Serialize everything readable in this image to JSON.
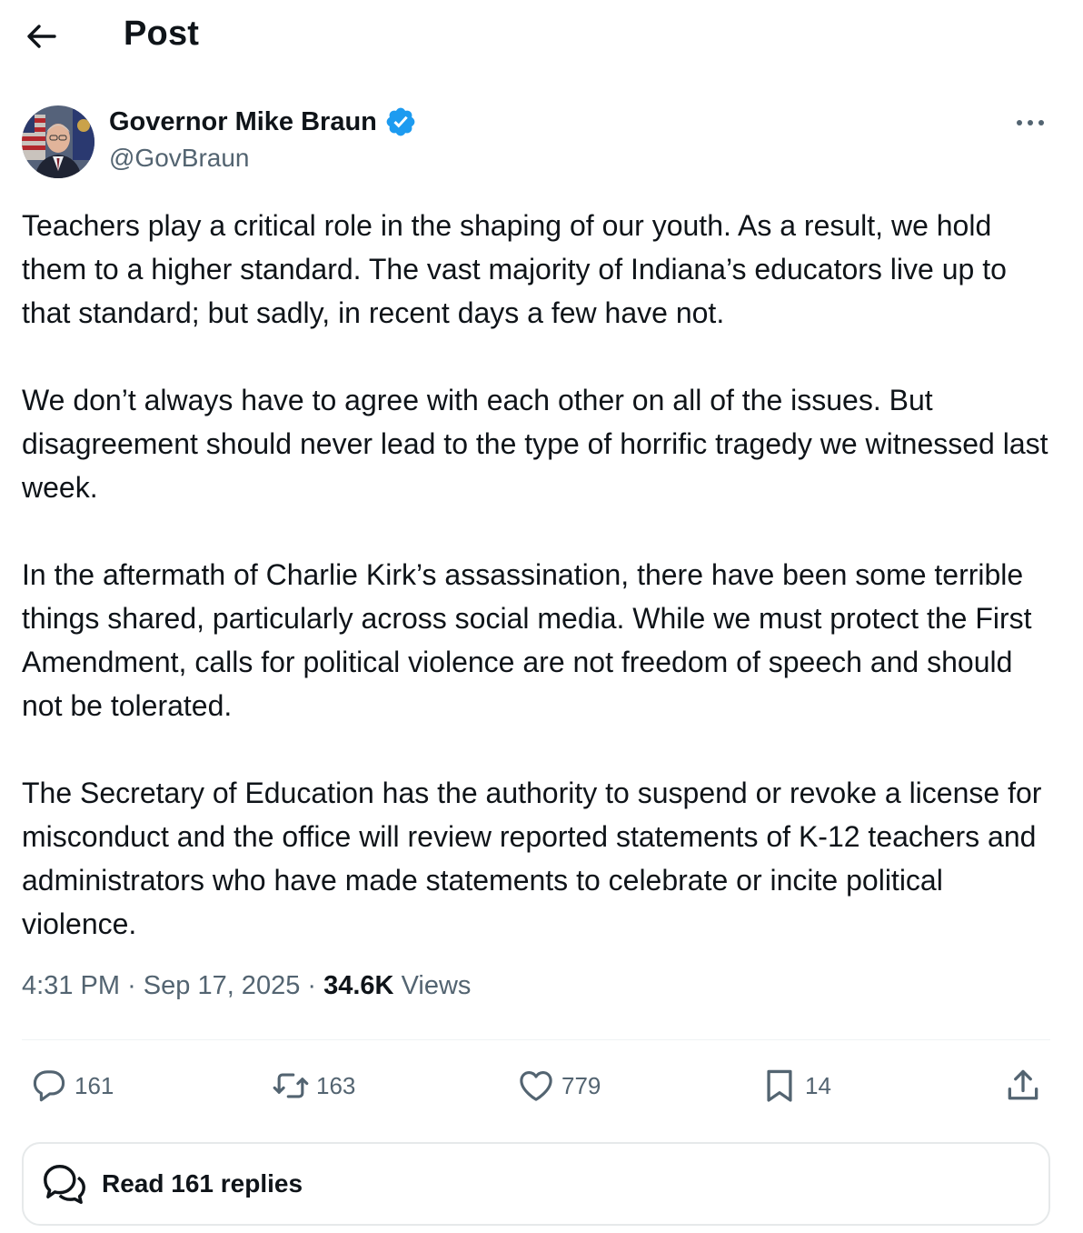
{
  "header": {
    "back_icon": "arrow-left-icon",
    "title": "Post"
  },
  "author": {
    "display_name": "Governor Mike Braun",
    "handle": "@GovBraun",
    "verified_icon": "verified-badge-icon",
    "verified_color": "#1d9bf0",
    "more_icon": "more-horizontal-icon"
  },
  "post": {
    "paragraphs": [
      "Teachers play a critical role in the shaping of our youth. As a result, we hold them to a higher standard. The vast majority of Indiana’s educators live up to that standard; but sadly, in recent days a few have not.",
      "We don’t always have to agree with each other on all of the issues. But disagreement should never lead to the type of horrific tragedy we witnessed last week.",
      "In the aftermath of Charlie Kirk’s assassination, there have been some terrible things shared, particularly across social media. While we must protect the First Amendment, calls for political violence are not freedom of speech and should not be tolerated.",
      "The Secretary of Education has the authority to suspend or revoke a license for misconduct and the office will review reported statements of K-12 teachers and administrators who have made statements to celebrate or incite political violence."
    ],
    "time": "4:31 PM",
    "separator": "·",
    "date": "Sep 17, 2025",
    "views_count": "34.6K",
    "views_label": "Views"
  },
  "actions": {
    "reply": {
      "icon": "reply-bubble-icon",
      "count": "161"
    },
    "repost": {
      "icon": "repost-icon",
      "count": "163"
    },
    "like": {
      "icon": "heart-icon",
      "count": "779"
    },
    "bookmark": {
      "icon": "bookmark-icon",
      "count": "14"
    },
    "share": {
      "icon": "share-upload-icon"
    }
  },
  "replies_button": {
    "icon": "conversation-bubbles-icon",
    "label": "Read 161 replies"
  },
  "colors": {
    "text_primary": "#0f1419",
    "text_secondary": "#536471",
    "divider": "#eff3f4",
    "verified_blue": "#1d9bf0"
  }
}
